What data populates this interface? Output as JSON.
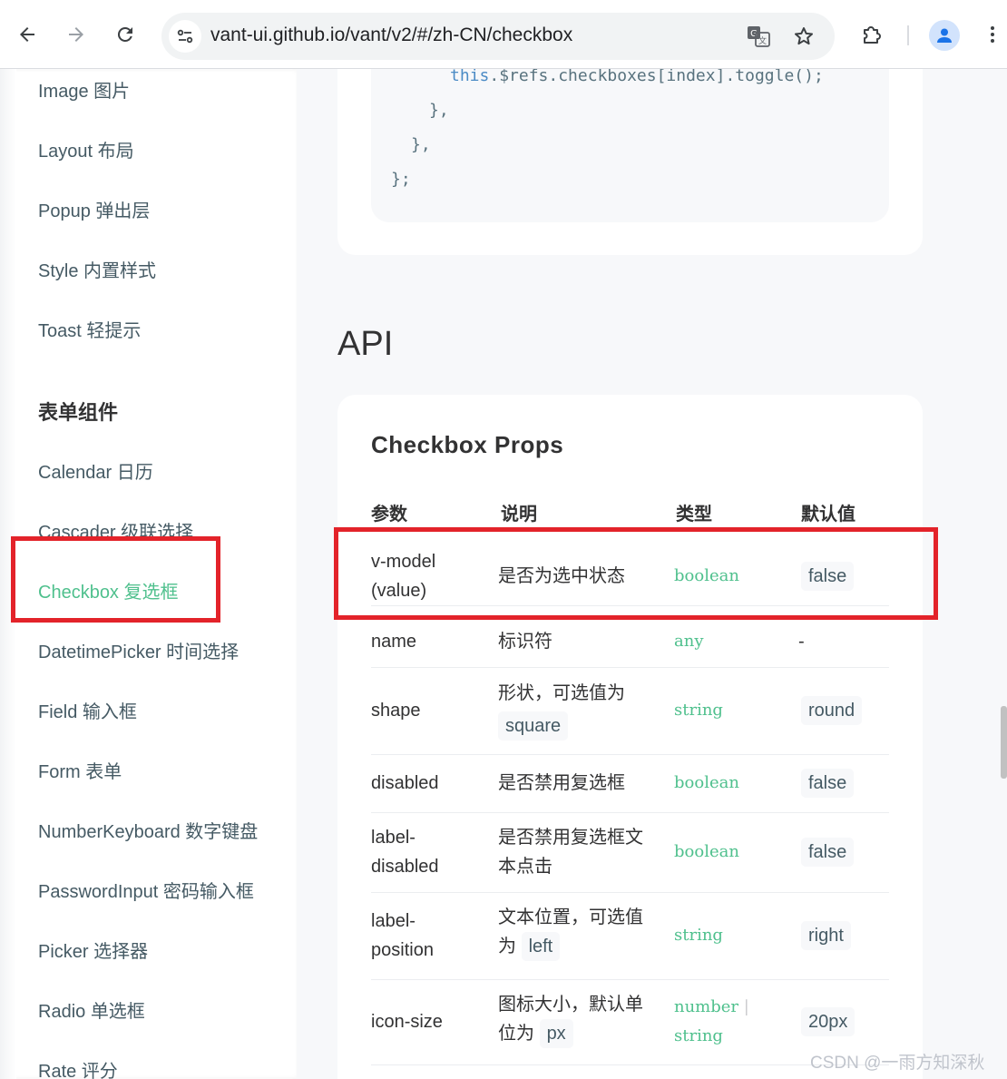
{
  "browser": {
    "url": "vant-ui.github.io/vant/v2/#/zh-CN/checkbox"
  },
  "sidebar": {
    "items_top": [
      {
        "label": "Image 图片"
      },
      {
        "label": "Layout 布局"
      },
      {
        "label": "Popup 弹出层"
      },
      {
        "label": "Style 内置样式"
      },
      {
        "label": "Toast 轻提示"
      }
    ],
    "group_title": "表单组件",
    "items_form": [
      {
        "label": "Calendar 日历"
      },
      {
        "label": "Cascader 级联选择"
      },
      {
        "label": "Checkbox 复选框",
        "active": true
      },
      {
        "label": "DatetimePicker 时间选择"
      },
      {
        "label": "Field 输入框"
      },
      {
        "label": "Form 表单"
      },
      {
        "label": "NumberKeyboard 数字键盘"
      },
      {
        "label": "PasswordInput 密码输入框"
      },
      {
        "label": "Picker 选择器"
      },
      {
        "label": "Radio 单选框"
      },
      {
        "label": "Rate 评分"
      }
    ]
  },
  "code": {
    "lines": [
      {
        "this": "this",
        "rest": ".$refs.checkboxes[index].toggle();"
      },
      {
        "text": "},"
      },
      {
        "text": "},"
      },
      {
        "text": "};"
      }
    ]
  },
  "api": {
    "heading": "API",
    "props_title": "Checkbox Props",
    "headers": [
      "参数",
      "说明",
      "类型",
      "默认值"
    ],
    "rows": [
      {
        "param_1": "v-model",
        "param_2": "(value)",
        "desc": "是否为选中状态",
        "type": "boolean",
        "default": "false"
      },
      {
        "param": "name",
        "desc": "标识符",
        "type": "any",
        "default": "-"
      },
      {
        "param": "shape",
        "desc_1": "形状，可选值为",
        "desc_chip": "square",
        "type": "string",
        "default": "round"
      },
      {
        "param": "disabled",
        "desc": "是否禁用复选框",
        "type": "boolean",
        "default": "false"
      },
      {
        "param_1": "label-",
        "param_2": "disabled",
        "desc_1": "是否禁用复选框文",
        "desc_2": "本点击",
        "type": "boolean",
        "default": "false"
      },
      {
        "param_1": "label-",
        "param_2": "position",
        "desc_1": "文本位置，可选值",
        "desc_2": "为",
        "desc_chip": "left",
        "type": "string",
        "default": "right"
      },
      {
        "param": "icon-size",
        "desc_1": "图标大小，默认单",
        "desc_2": "位为",
        "desc_chip": "px",
        "type_1": "number",
        "type_sep": "|",
        "type_2": "string",
        "default": "20px"
      }
    ]
  },
  "watermark": "CSDN @一雨方知深秋",
  "colors": {
    "accent": "#4fc08d",
    "annotation": "#e3232a",
    "text": "#323233",
    "muted": "#455a64"
  }
}
